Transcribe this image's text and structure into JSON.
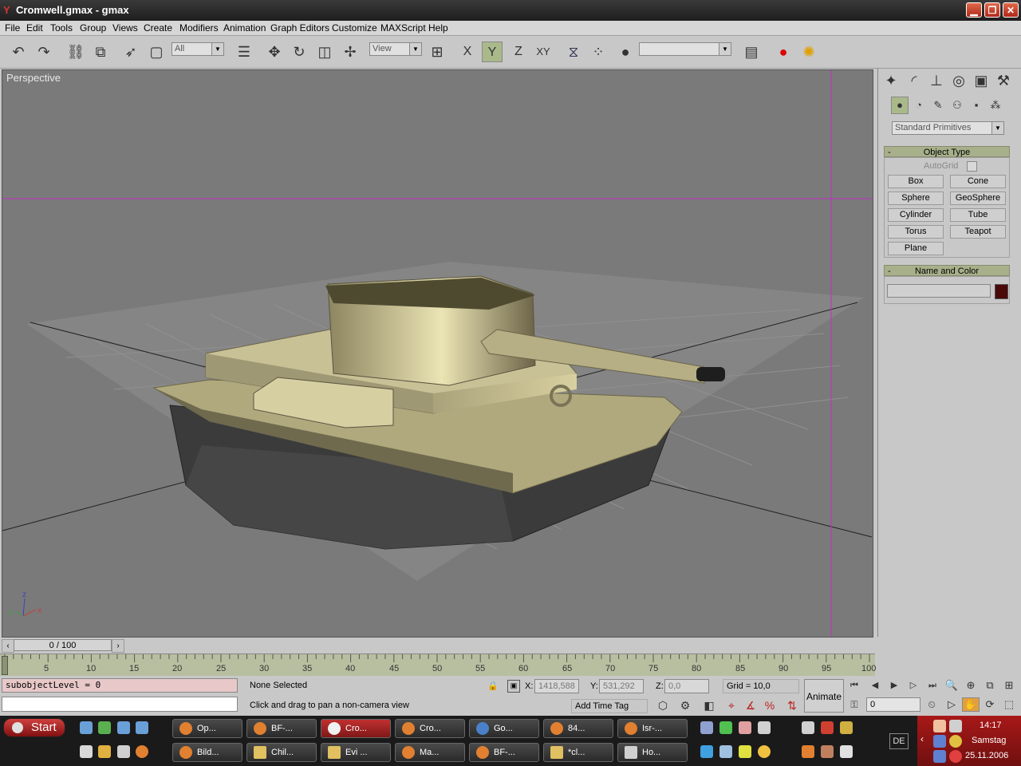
{
  "window": {
    "title": "Cromwell.gmax - gmax"
  },
  "menu": [
    "File",
    "Edit",
    "Tools",
    "Group",
    "Views",
    "Create",
    "Modifiers",
    "Animation",
    "Graph Editors",
    "Customize",
    "MAXScript",
    "Help"
  ],
  "toolbar": {
    "filter_value": "All",
    "ref_coord_value": "View",
    "axis_x": "X",
    "axis_y": "Y",
    "axis_z": "Z",
    "axis_xy": "XY",
    "named_sel_value": ""
  },
  "viewport": {
    "label": "Perspective",
    "axis_tripod": {
      "x": "x",
      "y": "y",
      "z": "z"
    }
  },
  "command_panel": {
    "category": "Standard Primitives",
    "object_type_header": "Object Type",
    "autogrid_label": "AutoGrid",
    "buttons": [
      "Box",
      "Cone",
      "Sphere",
      "GeoSphere",
      "Cylinder",
      "Tube",
      "Torus",
      "Teapot",
      "Plane"
    ],
    "name_color_header": "Name and Color",
    "name_value": "",
    "object_color": "#4a0808",
    "collapse_symbol": "-"
  },
  "timeline": {
    "slider_label": "0 / 100",
    "ticks": [
      "5",
      "10",
      "15",
      "20",
      "25",
      "30",
      "35",
      "40",
      "45",
      "50",
      "55",
      "60",
      "65",
      "70",
      "75",
      "80",
      "85",
      "90",
      "95",
      "100"
    ]
  },
  "status": {
    "listener_line": "subobjectLevel = 0",
    "listener_input": "",
    "selection": "None Selected",
    "prompt": "Click and drag to pan a non-camera view",
    "x_label": "X:",
    "x_value": "1418,588",
    "y_label": "Y:",
    "y_value": "531,292",
    "z_label": "Z:",
    "z_value": "0,0",
    "grid": "Grid = 10,0",
    "add_time_tag": "Add Time Tag",
    "animate": "Animate",
    "frame_value": "0"
  },
  "taskbar": {
    "start": "Start",
    "row1": [
      "Op...",
      "BF-...",
      "Cro...",
      "Cro...",
      "Go...",
      "84...",
      "Isr-..."
    ],
    "row2": [
      "Bild...",
      "Chil...",
      "Evi ...",
      "Ma...",
      "BF-...",
      "*cl...",
      "Ho..."
    ],
    "language": "DE",
    "time": "14:17",
    "day": "Samstag",
    "date": "25.11.2006"
  }
}
